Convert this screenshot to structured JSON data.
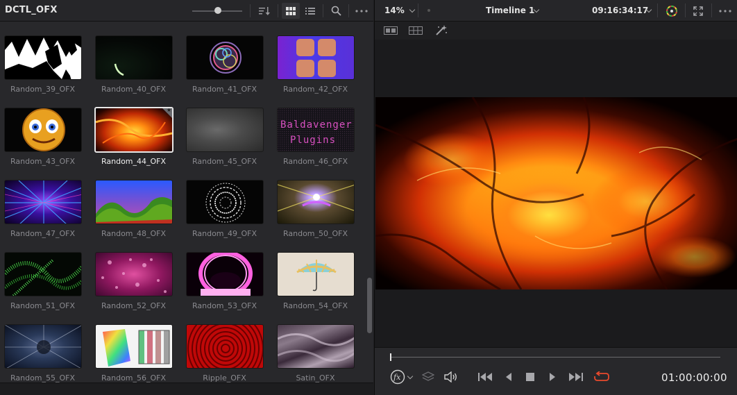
{
  "bin": {
    "title": "DCTL_OFX"
  },
  "clips": [
    {
      "label": "Random_39_OFX"
    },
    {
      "label": "Random_40_OFX"
    },
    {
      "label": "Random_41_OFX"
    },
    {
      "label": "Random_42_OFX"
    },
    {
      "label": "Random_43_OFX"
    },
    {
      "label": "Random_44_OFX",
      "selected": true
    },
    {
      "label": "Random_45_OFX"
    },
    {
      "label": "Random_46_OFX",
      "thumb_text": [
        "Baldavenger",
        "Plugins"
      ]
    },
    {
      "label": "Random_47_OFX"
    },
    {
      "label": "Random_48_OFX"
    },
    {
      "label": "Random_49_OFX"
    },
    {
      "label": "Random_50_OFX"
    },
    {
      "label": "Random_51_OFX"
    },
    {
      "label": "Random_52_OFX"
    },
    {
      "label": "Random_53_OFX"
    },
    {
      "label": "Random_54_OFX"
    },
    {
      "label": "Random_55_OFX"
    },
    {
      "label": "Random_56_OFX"
    },
    {
      "label": "Ripple_OFX"
    },
    {
      "label": "Satin_OFX"
    }
  ],
  "viewer": {
    "zoom": "14%",
    "timeline_name": "Timeline 1",
    "source_timecode": "09:16:34:17",
    "record_timecode": "01:00:00:00"
  },
  "colors": {
    "accent_loop": "#e8492c",
    "panel_bg": "#28282b",
    "selection_border": "#e8e8e8"
  },
  "icons": {
    "header": [
      "sort-icon",
      "grid-view-icon",
      "list-view-icon",
      "search-icon",
      "more-options-icon"
    ],
    "viewer_header": [
      "color-wheel-icon",
      "fullscreen-icon",
      "more-options-icon"
    ],
    "transport": [
      "effects-fx-icon",
      "layers-icon",
      "volume-icon",
      "skip-to-start-icon",
      "step-back-icon",
      "stop-icon",
      "play-icon",
      "skip-to-end-icon",
      "loop-icon"
    ]
  }
}
